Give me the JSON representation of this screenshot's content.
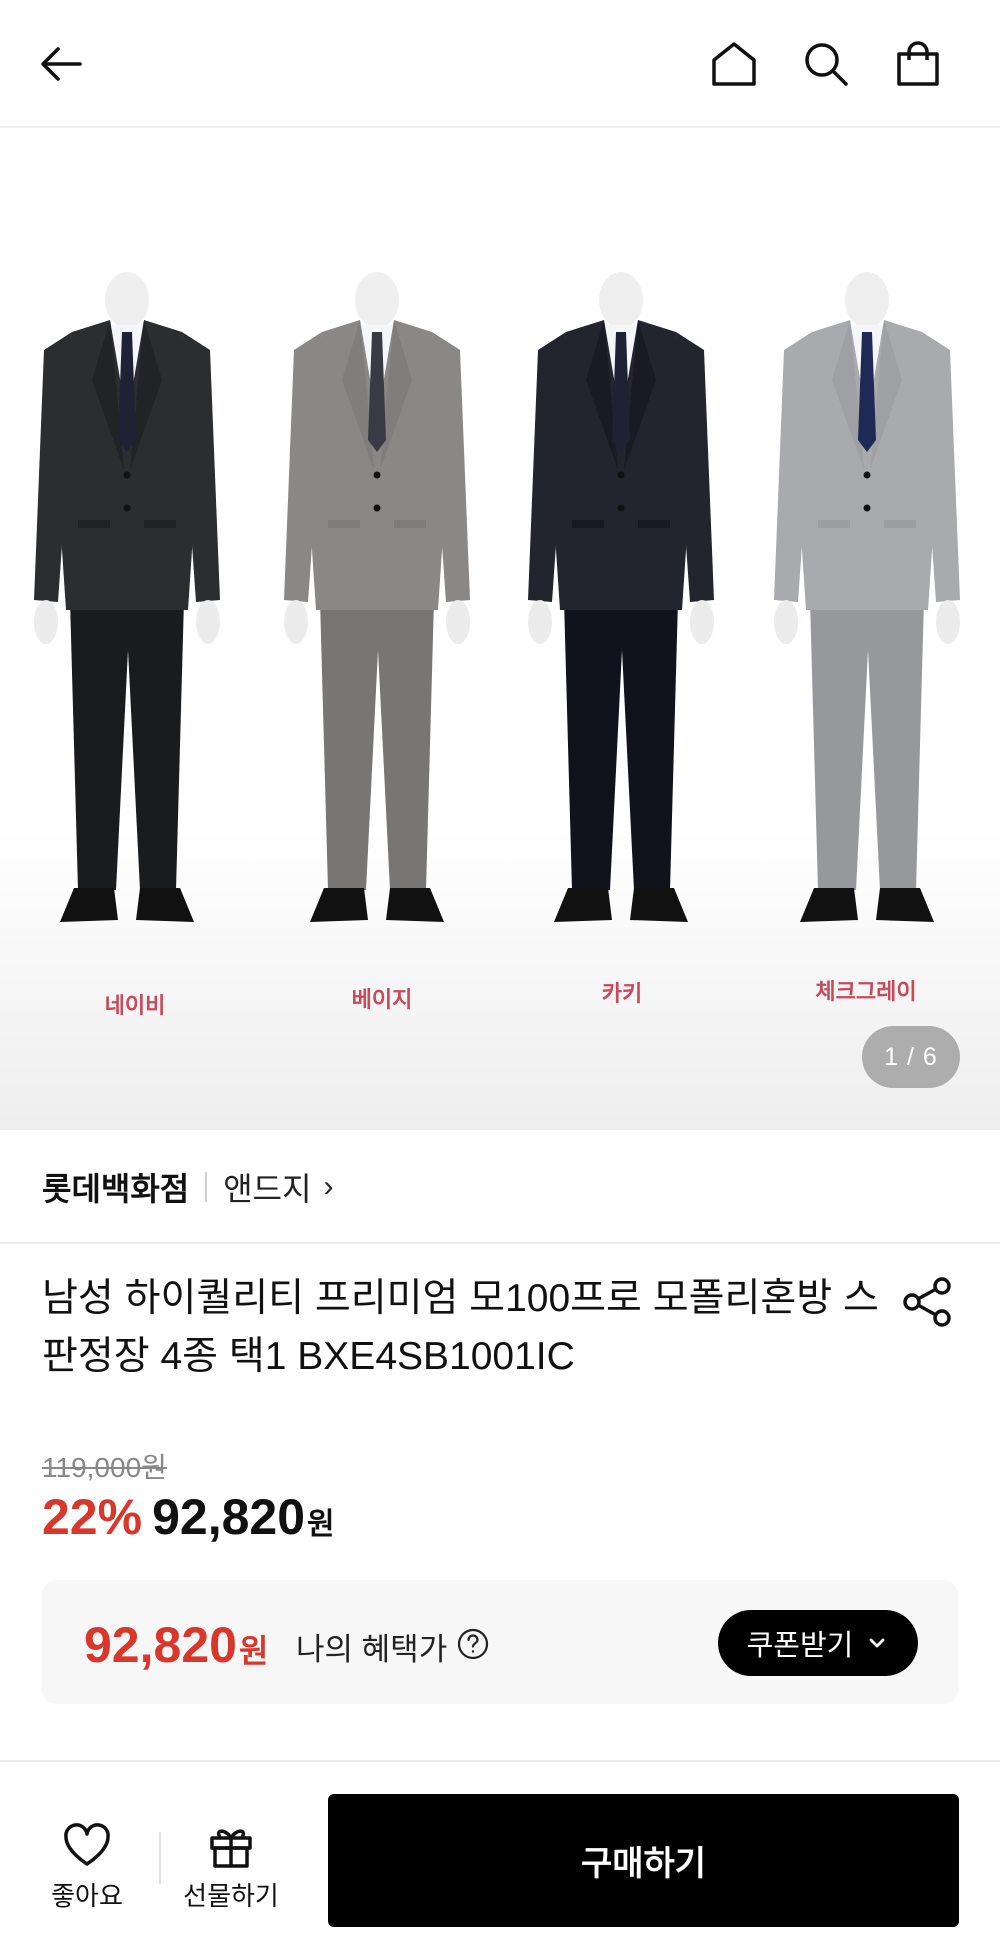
{
  "header": {
    "back_icon": "arrow-left-icon",
    "home_icon": "home-icon",
    "search_icon": "search-icon",
    "cart_icon": "shopping-bag-icon"
  },
  "gallery": {
    "color_labels": [
      "네이비",
      "베이지",
      "카키",
      "체크그레이"
    ],
    "suit_colors": [
      "#2b2d2e",
      "#8a8886",
      "#22252d",
      "#a9aaad"
    ],
    "pager": "1 / 6"
  },
  "brand_row": {
    "store": "롯데백화점",
    "brand": "앤드지",
    "chevron": "›"
  },
  "product": {
    "title": "남성 하이퀄리티 프리미엄 모100프로 모폴리혼방 스판정장 4종 택1 BXE4SB1001IC",
    "share_icon": "share-icon"
  },
  "price": {
    "original": "119,000원",
    "discount": "22%",
    "sale": "92,820",
    "currency": "원"
  },
  "benefit": {
    "price": "92,820",
    "currency": "원",
    "label": "나의 혜택가",
    "coupon_button": "쿠폰받기"
  },
  "bottom_bar": {
    "like_label": "좋아요",
    "gift_label": "선물하기",
    "buy_label": "구매하기"
  },
  "colors": {
    "accent_red": "#d9372b",
    "black": "#000000"
  }
}
